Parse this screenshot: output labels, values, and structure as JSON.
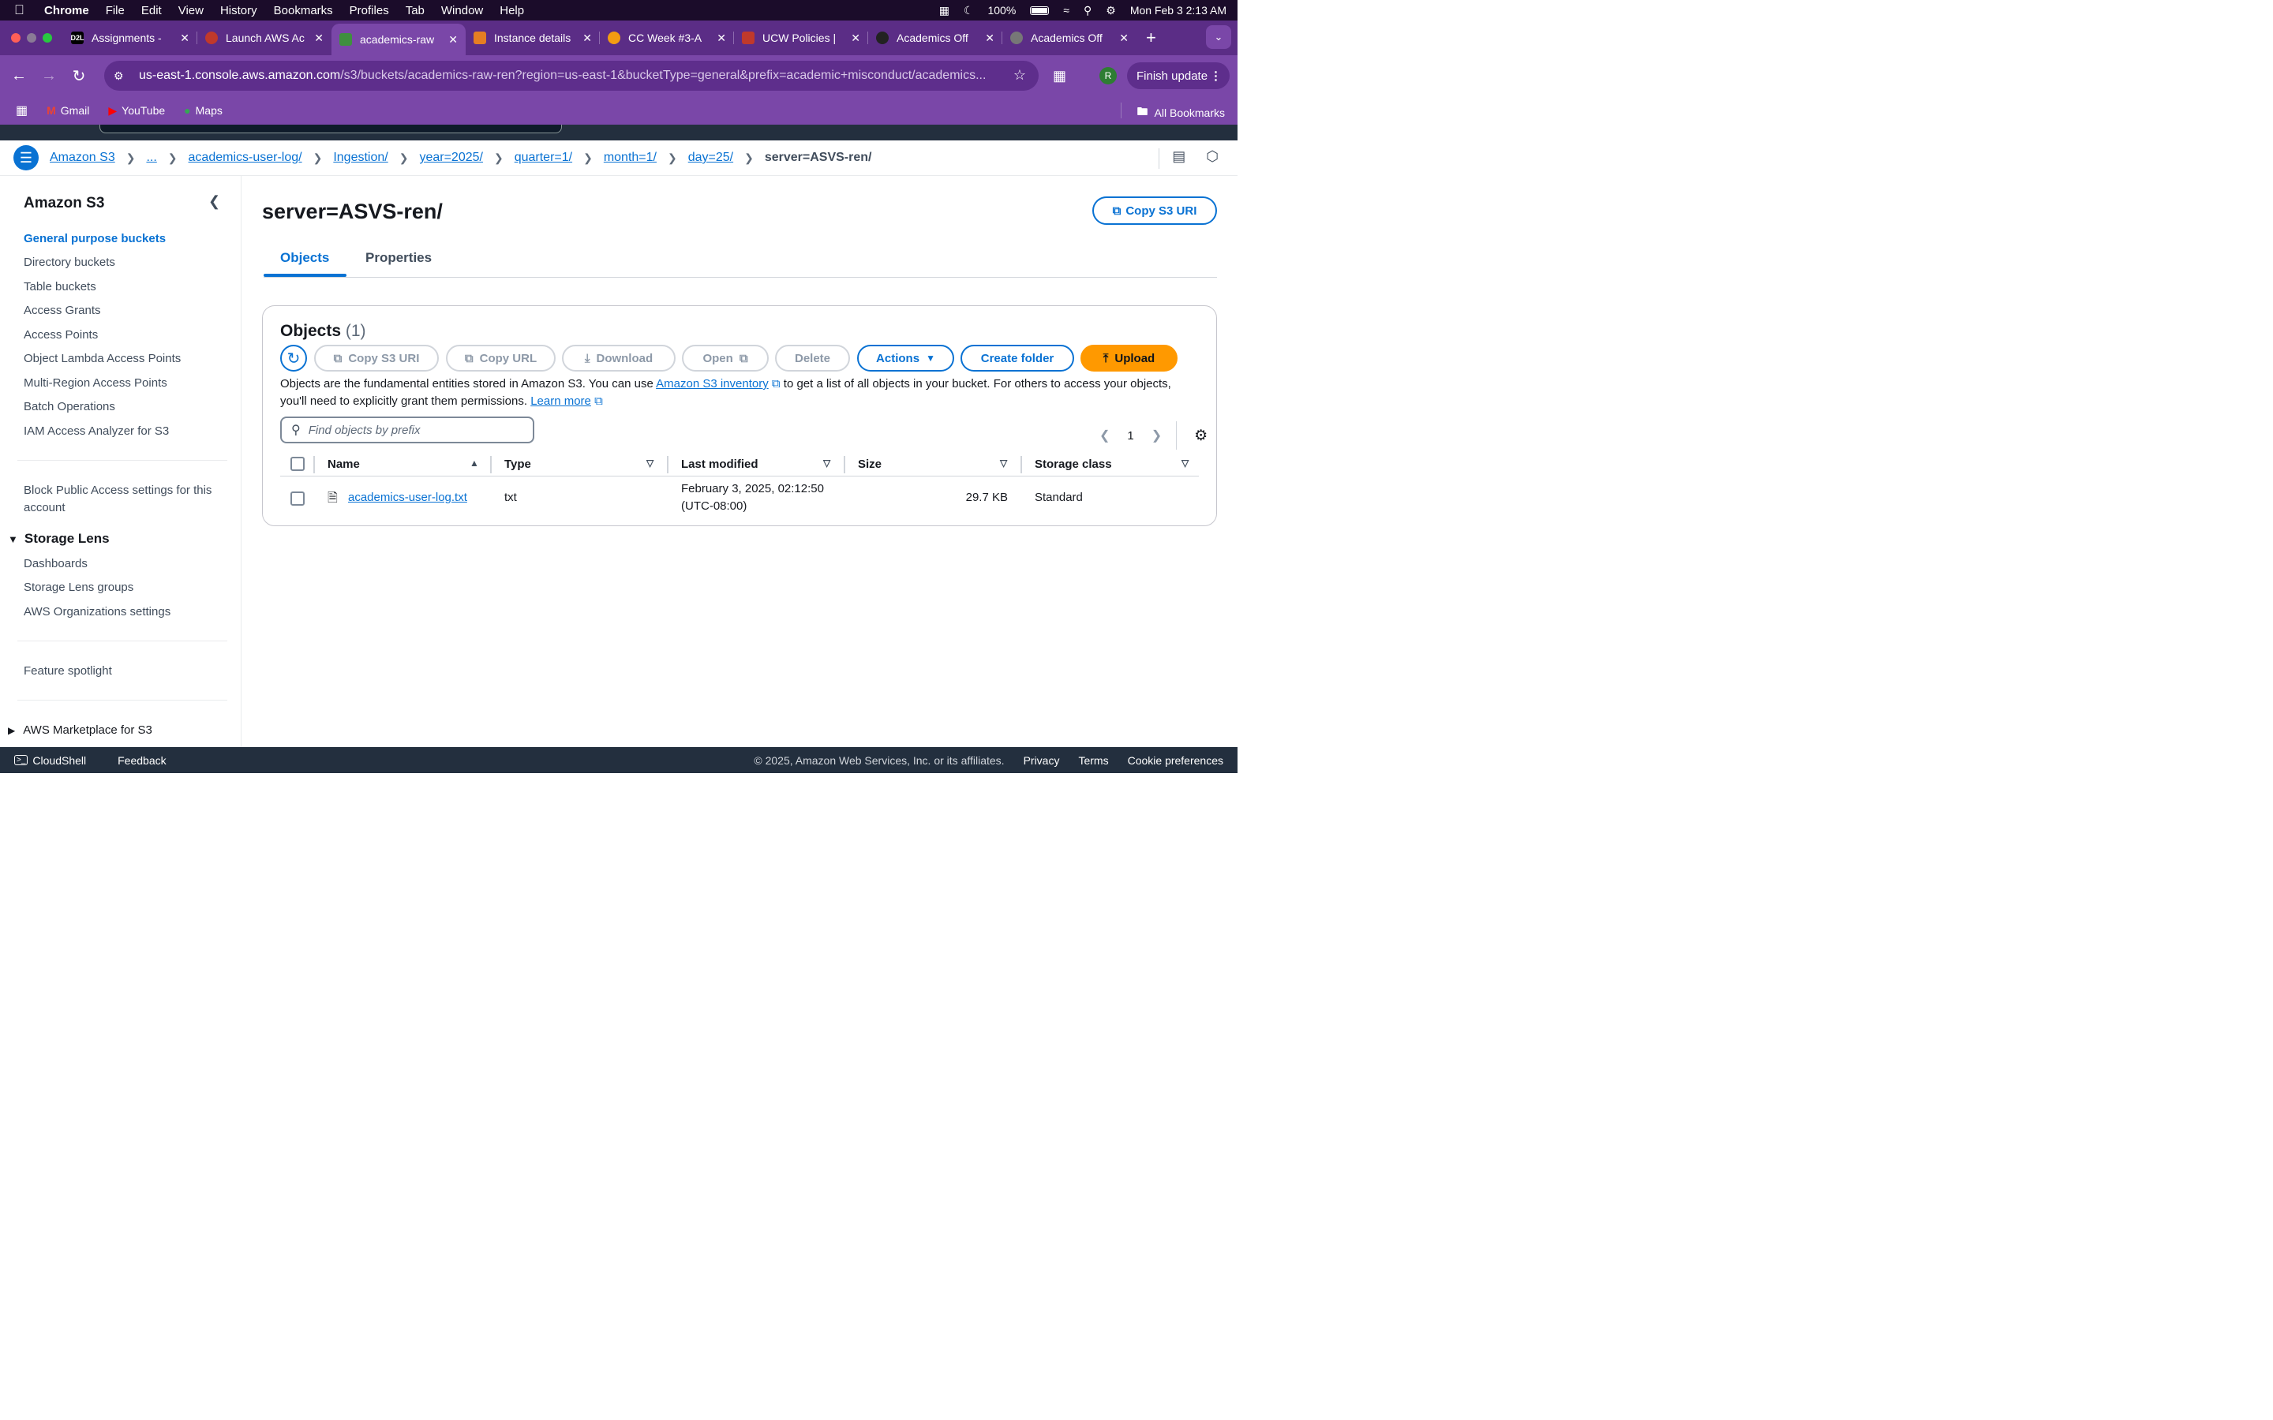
{
  "menubar": {
    "app": "Chrome",
    "items": [
      "File",
      "Edit",
      "View",
      "History",
      "Bookmarks",
      "Profiles",
      "Tab",
      "Window",
      "Help"
    ],
    "battery": "100%",
    "datetime": "Mon Feb 3  2:13 AM"
  },
  "tabs": [
    {
      "title": "Assignments -",
      "favicon": "D2L",
      "color": "#000000"
    },
    {
      "title": "Launch AWS Ac",
      "favicon": "",
      "color": "#c0392b"
    },
    {
      "title": "academics-raw",
      "favicon": "",
      "color": "#3f8f3f"
    },
    {
      "title": "Instance details",
      "favicon": "",
      "color": "#e67e22"
    },
    {
      "title": "CC Week #3-A",
      "favicon": "",
      "color": "#f39c12"
    },
    {
      "title": "UCW Policies |",
      "favicon": "",
      "color": "#c0392b"
    },
    {
      "title": "Academics Off",
      "favicon": "",
      "color": "#222222"
    },
    {
      "title": "Academics Off",
      "favicon": "",
      "color": "#777777"
    }
  ],
  "address": {
    "host": "us-east-1.console.aws.amazon.com",
    "path": "/s3/buckets/academics-raw-ren?region=us-east-1&bucketType=general&prefix=academic+misconduct/academics...",
    "profile_initial": "R",
    "finish_update": "Finish update"
  },
  "bookmarks": {
    "items": [
      "Gmail",
      "YouTube",
      "Maps"
    ],
    "all": "All Bookmarks"
  },
  "breadcrumb": [
    "Amazon S3",
    "...",
    "academics-user-log/",
    "Ingestion/",
    "year=2025/",
    "quarter=1/",
    "month=1/",
    "day=25/"
  ],
  "breadcrumb_current": "server=ASVS-ren/",
  "sidebar": {
    "title": "Amazon S3",
    "items": [
      "General purpose buckets",
      "Directory buckets",
      "Table buckets",
      "Access Grants",
      "Access Points",
      "Object Lambda Access Points",
      "Multi-Region Access Points",
      "Batch Operations",
      "IAM Access Analyzer for S3"
    ],
    "block_public_1": "Block Public Access settings for this",
    "block_public_2": "account",
    "storage_lens": "Storage Lens",
    "lens_items": [
      "Dashboards",
      "Storage Lens groups",
      "AWS Organizations settings"
    ],
    "feature_spotlight": "Feature spotlight",
    "marketplace": "AWS Marketplace for S3"
  },
  "main": {
    "title": "server=ASVS-ren/",
    "copy_uri": "Copy S3 URI",
    "tabs": [
      "Objects",
      "Properties"
    ],
    "objects_title": "Objects",
    "objects_count": "(1)",
    "actions": {
      "copy_s3_uri": "Copy S3 URI",
      "copy_url": "Copy URL",
      "download": "Download",
      "open": "Open",
      "delete": "Delete",
      "actions": "Actions",
      "create_folder": "Create folder",
      "upload": "Upload"
    },
    "desc_1": "Objects are the fundamental entities stored in Amazon S3. You can use ",
    "desc_link1": "Amazon S3 inventory",
    "desc_2": " to get a list of all objects in your bucket. For others to access your objects, you'll need to explicitly grant them permissions. ",
    "desc_link2": "Learn more",
    "search_placeholder": "Find objects by prefix",
    "page": "1",
    "columns": [
      "Name",
      "Type",
      "Last modified",
      "Size",
      "Storage class"
    ],
    "rows": [
      {
        "name": "academics-user-log.txt",
        "type": "txt",
        "modified_1": "February 3, 2025, 02:12:50",
        "modified_2": "(UTC-08:00)",
        "size": "29.7 KB",
        "storage": "Standard"
      }
    ]
  },
  "footer": {
    "cloudshell": "CloudShell",
    "feedback": "Feedback",
    "copyright": "© 2025, Amazon Web Services, Inc. or its affiliates.",
    "links": [
      "Privacy",
      "Terms",
      "Cookie preferences"
    ]
  }
}
